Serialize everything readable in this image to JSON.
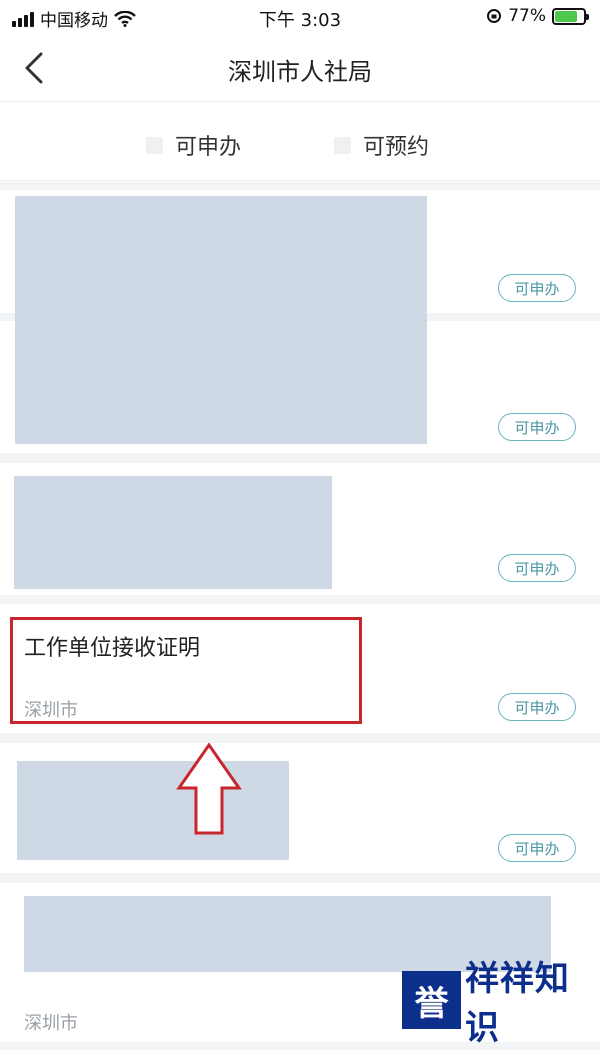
{
  "status_bar": {
    "carrier": "中国移动",
    "time": "下午 3:03",
    "battery": "77%",
    "battery_level": 0.77
  },
  "header": {
    "title": "深圳市人社局"
  },
  "filters": [
    {
      "label": "可申办"
    },
    {
      "label": "可预约"
    }
  ],
  "items": [
    {
      "badge": "可申办"
    },
    {
      "badge": "可申办"
    },
    {
      "badge": "可申办"
    },
    {
      "title": "工作单位接收证明",
      "city": "深圳市",
      "badge": "可申办"
    },
    {
      "badge": "可申办"
    },
    {
      "city": "深圳市"
    }
  ],
  "watermark": {
    "logo": "誉",
    "text": "祥祥知识"
  },
  "colors": {
    "badge_border": "#6ab3c0",
    "highlight": "#c8252c",
    "redact": "#cfd9e5",
    "watermark": "#0d2f8c"
  }
}
